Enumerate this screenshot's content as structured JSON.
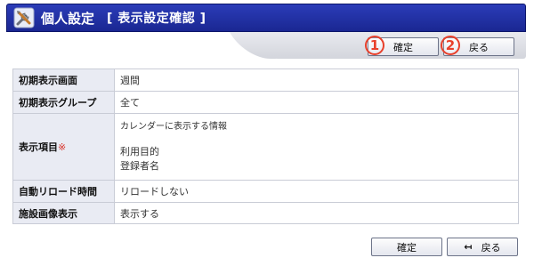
{
  "header": {
    "title": "個人設定",
    "subtitle": "[ 表示設定確認 ]",
    "icon": "tools-icon"
  },
  "toolbar": {
    "confirm_label": "確定",
    "back_label": "戻る",
    "confirm_badge": "1",
    "back_badge": "2"
  },
  "settings": [
    {
      "label": "初期表示画面",
      "value": "週間"
    },
    {
      "label": "初期表示グループ",
      "value": "全て"
    },
    {
      "label": "表示項目",
      "required_mark": "※",
      "note": "カレンダーに表示する情報",
      "items": [
        "利用目的",
        "登録者名"
      ]
    },
    {
      "label": "自動リロード時間",
      "value": "リロードしない"
    },
    {
      "label": "施設画像表示",
      "value": "表示する"
    }
  ],
  "footer": {
    "confirm_label": "確定",
    "back_label": "戻る"
  },
  "colors": {
    "header_bg": "#1f2ca4",
    "label_bg": "#e9ebf3",
    "badge": "#e8402b",
    "required": "#d9342b"
  }
}
